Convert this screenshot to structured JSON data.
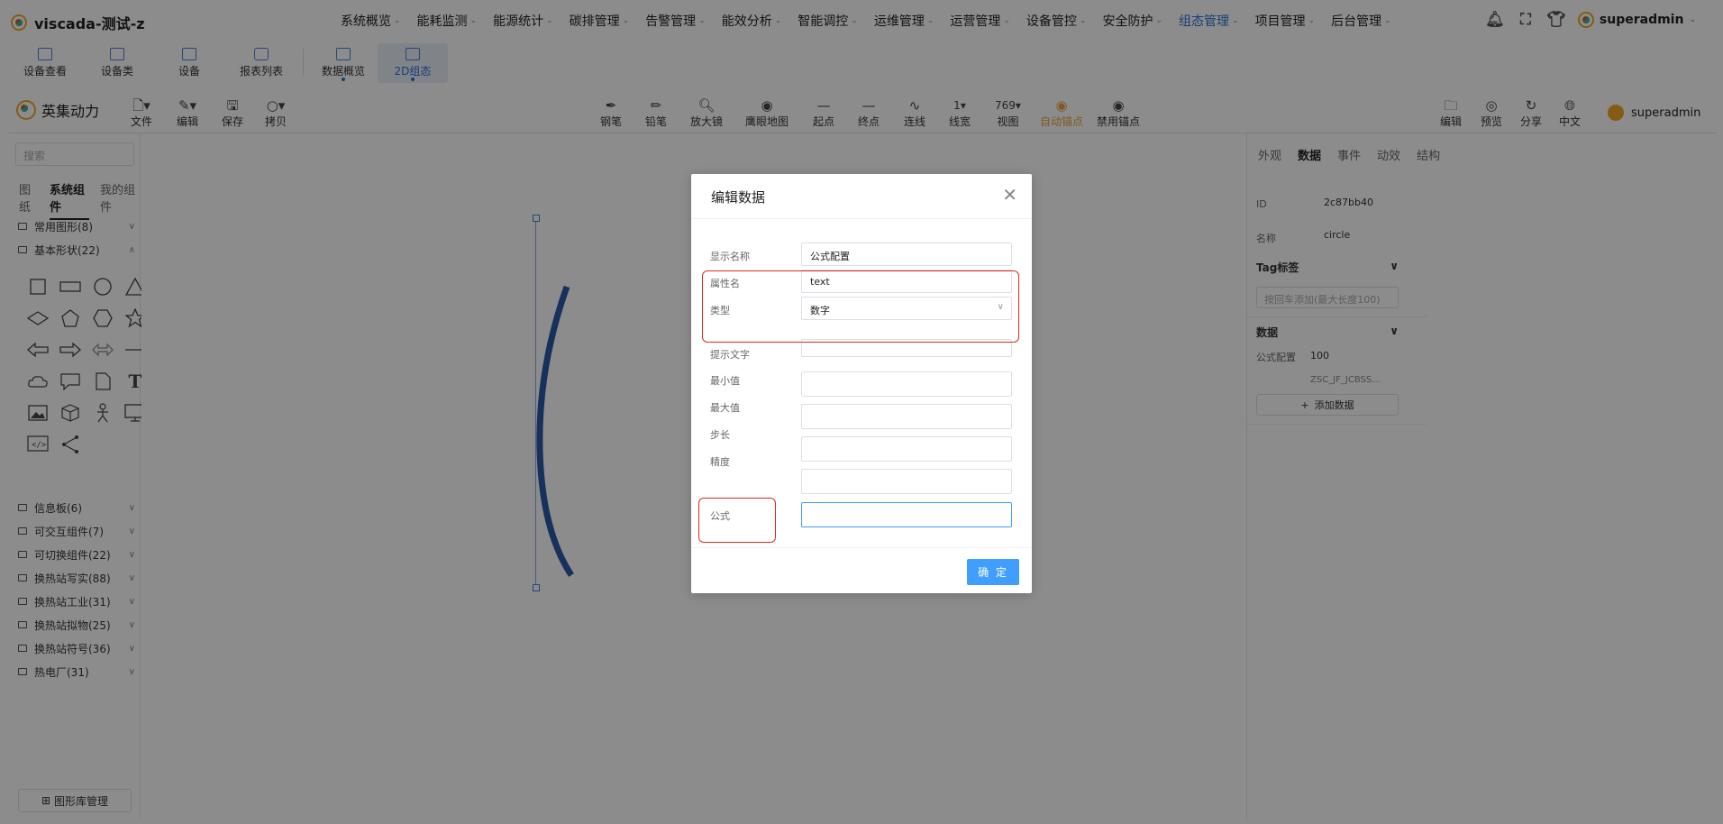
{
  "app": {
    "title": "viscada-测试-z"
  },
  "topmenu": [
    "系统概览",
    "能耗监测",
    "能源统计",
    "碳排管理",
    "告警管理",
    "能效分析",
    "智能调控",
    "运维管理",
    "运营管理",
    "设备管控",
    "安全防护",
    "组态管理",
    "项目管理",
    "后台管理"
  ],
  "topmenu_active": "组态管理",
  "user": {
    "name": "superadmin"
  },
  "subtabs": [
    {
      "label": "设备查看"
    },
    {
      "label": "设备类"
    },
    {
      "label": "设备"
    },
    {
      "label": "报表列表"
    },
    {
      "label": "数据概览"
    },
    {
      "label": "2D组态"
    }
  ],
  "editor": {
    "brand": "英集动力",
    "left_tools": [
      "文件",
      "编辑",
      "保存",
      "拷贝"
    ],
    "center_tools": [
      "钢笔",
      "铅笔",
      "放大镜",
      "鹰眼地图",
      "起点",
      "终点",
      "连线",
      "线宽",
      "视图",
      "自动锚点",
      "禁用锚点"
    ],
    "line_width_value": "1",
    "zoom_value": "769",
    "right_tools": [
      "编辑",
      "预览",
      "分享",
      "中文"
    ],
    "user": "superadmin"
  },
  "left_panel": {
    "search_placeholder": "搜索",
    "tabs": [
      "图纸",
      "系统组件",
      "我的组件"
    ],
    "categories": [
      "常用图形(8)",
      "基本形状(22)",
      "信息板(6)",
      "可交互组件(7)",
      "可切换组件(22)",
      "换热站写实(88)",
      "换热站工业(31)",
      "换热站拟物(25)",
      "换热站符号(36)",
      "热电厂(31)"
    ],
    "lib_button": "图形库管理"
  },
  "right_panel": {
    "tabs": [
      "外观",
      "数据",
      "事件",
      "动效",
      "结构"
    ],
    "id_label": "ID",
    "id_value": "2c87bb40",
    "name_label": "名称",
    "name_value": "circle",
    "tag_section": "Tag标签",
    "tag_placeholder": "按回车添加(最大长度100)",
    "data_section": "数据",
    "data_row_label": "公式配置",
    "data_row_value": "100",
    "data_row_sub": "ZSC_JF_JCBSS...",
    "add_data": "添加数据"
  },
  "dialog": {
    "title": "编辑数据",
    "fields": [
      {
        "label": "显示名称",
        "value": "公式配置"
      },
      {
        "label": "属性名",
        "value": "text"
      },
      {
        "label": "类型",
        "value": "数字"
      },
      {
        "label": "提示文字",
        "value": ""
      },
      {
        "label": "最小值",
        "value": ""
      },
      {
        "label": "最大值",
        "value": ""
      },
      {
        "label": "步长",
        "value": ""
      },
      {
        "label": "精度",
        "value": ""
      },
      {
        "label": "公式",
        "value": ""
      }
    ],
    "ok_button": "确 定"
  },
  "colors": {
    "accent": "#409eff",
    "active_menu": "#2d6fd6",
    "highlight_box": "#e0281e",
    "circle_stroke": "#2a5aa8"
  }
}
